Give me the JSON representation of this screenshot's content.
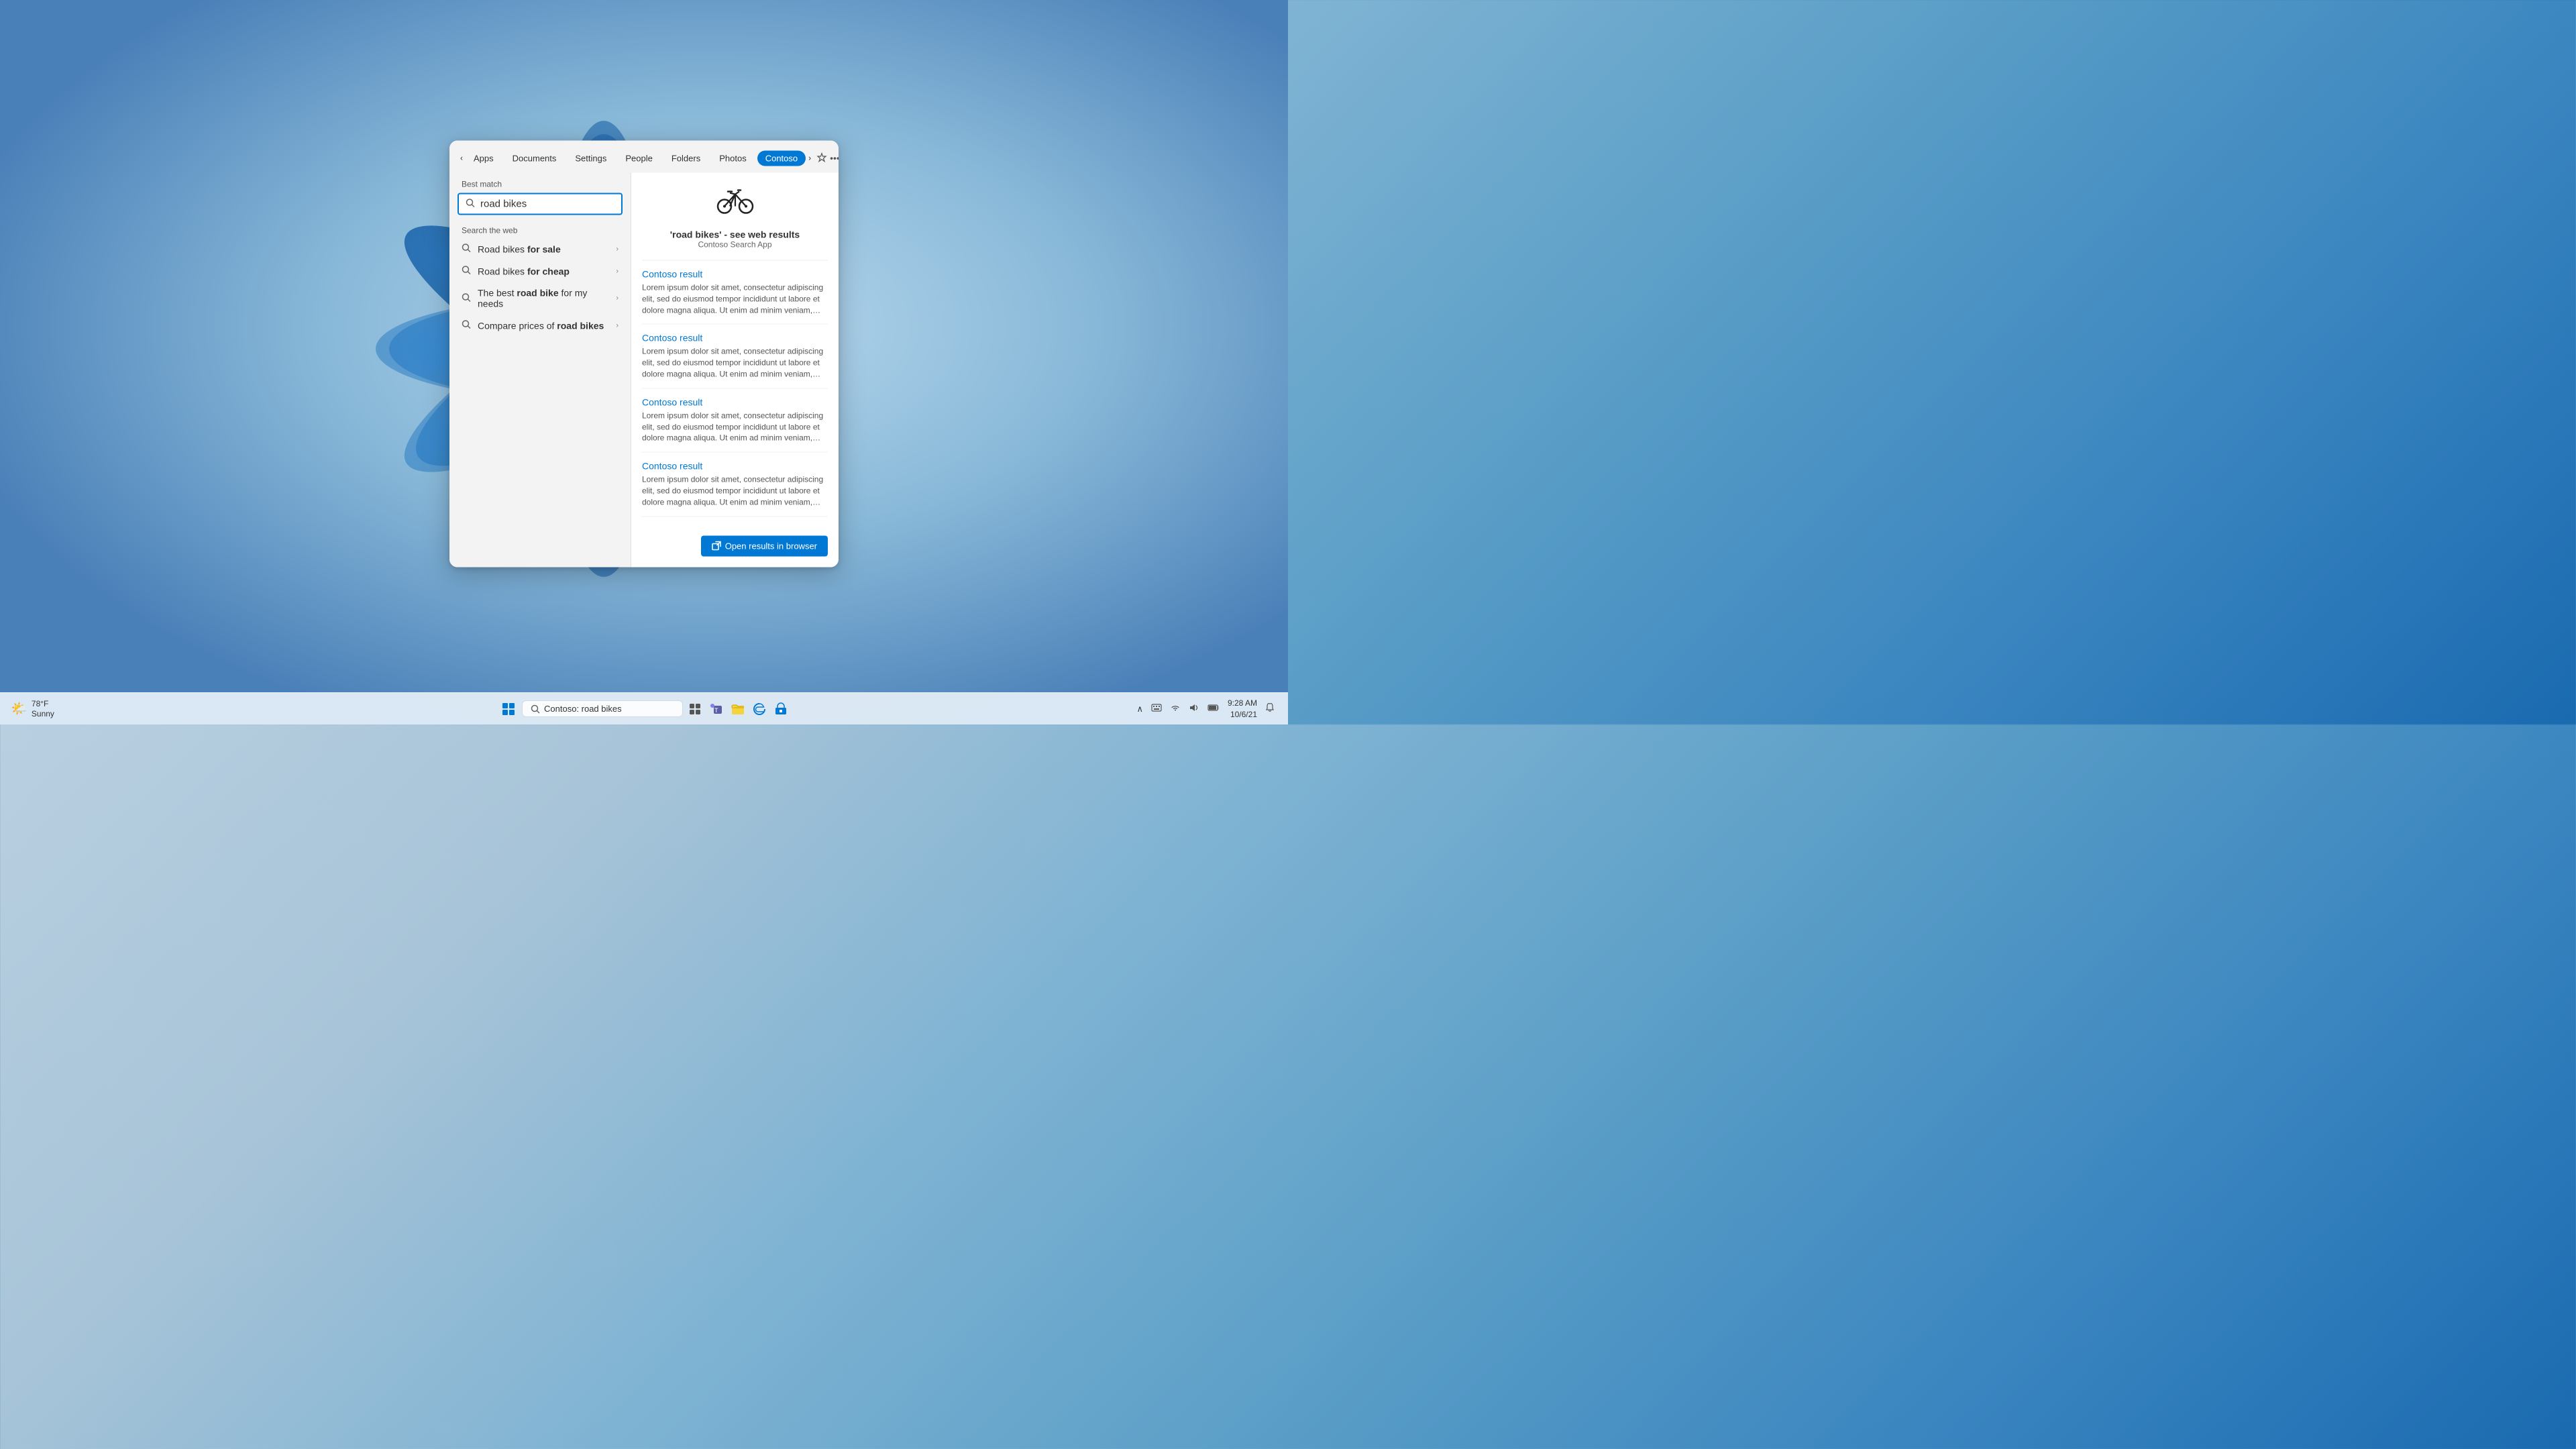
{
  "desktop": {
    "background": "Windows 11 Bloom"
  },
  "search_popup": {
    "tabs": [
      {
        "id": "apps",
        "label": "Apps",
        "active": false
      },
      {
        "id": "documents",
        "label": "Documents",
        "active": false
      },
      {
        "id": "settings",
        "label": "Settings",
        "active": false
      },
      {
        "id": "people",
        "label": "People",
        "active": false
      },
      {
        "id": "folders",
        "label": "Folders",
        "active": false
      },
      {
        "id": "photos",
        "label": "Photos",
        "active": false
      },
      {
        "id": "contoso",
        "label": "Contoso",
        "active": true
      }
    ],
    "best_match_label": "Best match",
    "search_value": "road bikes",
    "search_section_label": "Search the web",
    "suggestions": [
      {
        "id": "s1",
        "text_before": "Road bikes ",
        "bold": "for sale",
        "text_after": ""
      },
      {
        "id": "s2",
        "text_before": "Road bikes ",
        "bold": "for cheap",
        "text_after": ""
      },
      {
        "id": "s3",
        "text_before": "The best ",
        "bold": "road bike",
        "text_after": " for my needs"
      },
      {
        "id": "s4",
        "text_before": "Compare prices of ",
        "bold": "road bikes",
        "text_after": ""
      }
    ],
    "right_panel": {
      "result_title": "'road bikes' - see web results",
      "result_subtitle": "Contoso Search App",
      "results": [
        {
          "id": "r1",
          "title": "Contoso result",
          "desc": "Lorem ipsum dolor sit amet, consectetur adipiscing elit, sed do eiusmod tempor incididunt ut labore et dolore magna aliqua. Ut enim ad minim veniam, quis nostrud exercitation ullamco..."
        },
        {
          "id": "r2",
          "title": "Contoso result",
          "desc": "Lorem ipsum dolor sit amet, consectetur adipiscing elit, sed do eiusmod tempor incididunt ut labore et dolore magna aliqua. Ut enim ad minim veniam, quis nostrud exercitation ullamco..."
        },
        {
          "id": "r3",
          "title": "Contoso result",
          "desc": "Lorem ipsum dolor sit amet, consectetur adipiscing elit, sed do eiusmod tempor incididunt ut labore et dolore magna aliqua. Ut enim ad minim veniam, quis nostrud exercitation ullamco..."
        },
        {
          "id": "r4",
          "title": "Contoso result",
          "desc": "Lorem ipsum dolor sit amet, consectetur adipiscing elit, sed do eiusmod tempor incididunt ut labore et dolore magna aliqua. Ut enim ad minim veniam, quis nostrud exercitation ullamco..."
        }
      ],
      "open_browser_label": "Open results in browser"
    }
  },
  "taskbar": {
    "weather_temp": "78°F",
    "weather_desc": "Sunny",
    "search_placeholder": "Contoso: road bikes",
    "date": "10/6/21",
    "time": "9:28 AM"
  }
}
